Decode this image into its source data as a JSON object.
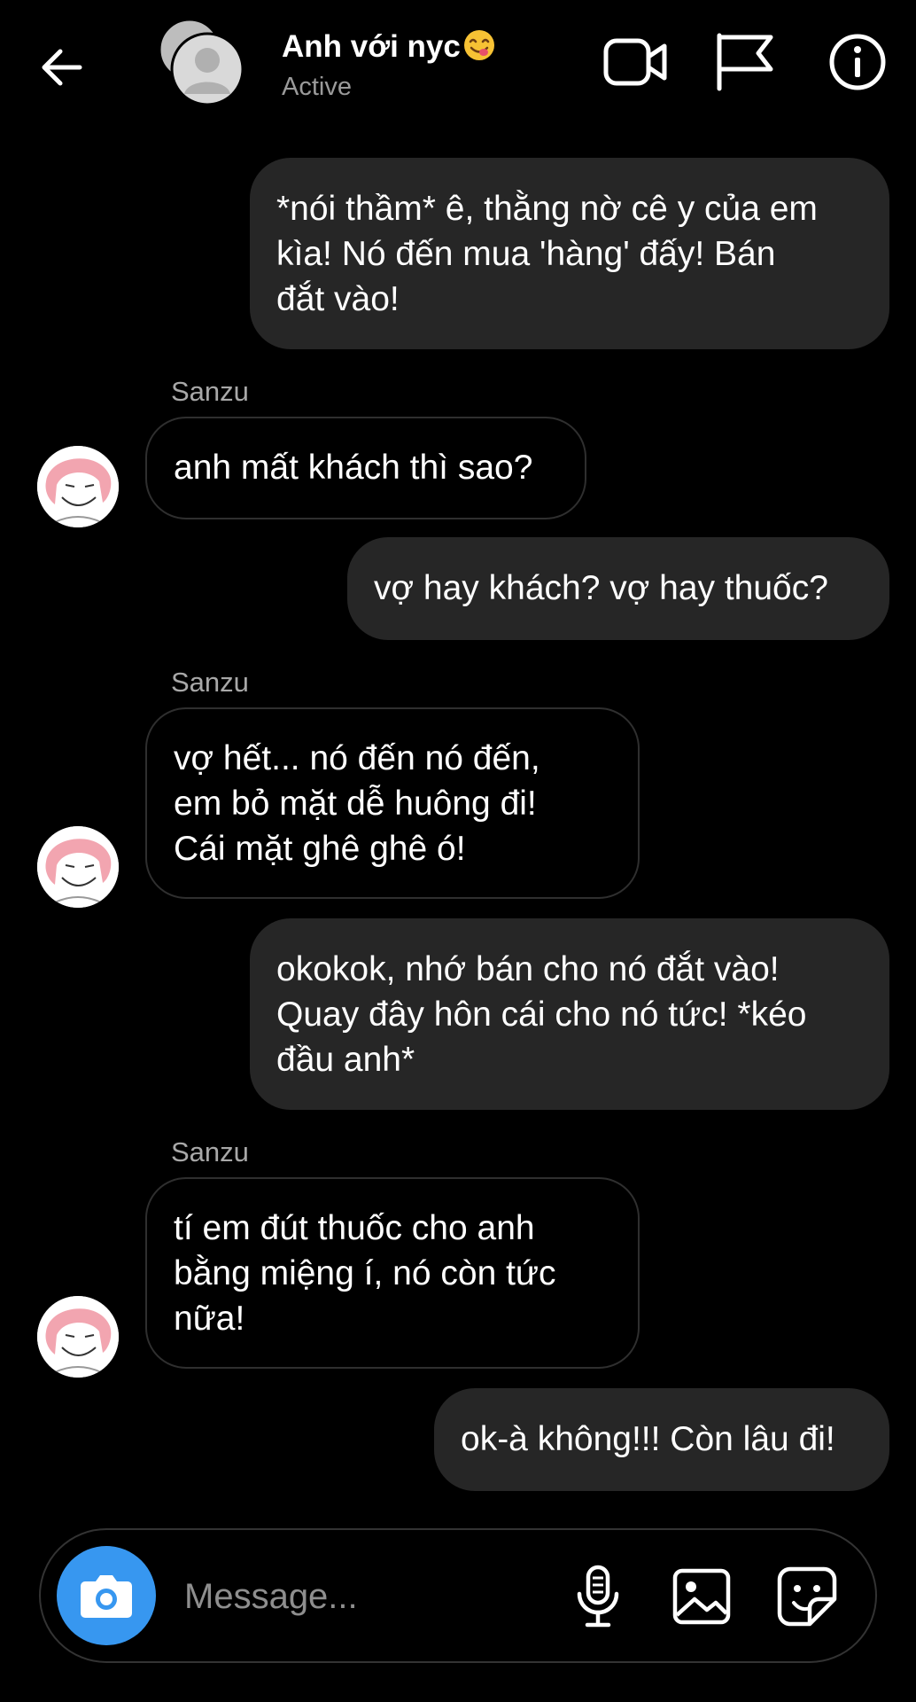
{
  "header": {
    "title": "Anh với nyc",
    "status": "Active"
  },
  "messages": [
    {
      "direction": "out",
      "text_lines": [
        "*nói thầm* ê, thằng nờ cê y của em",
        "kìa! Nó đến mua 'hàng' đấy! Bán",
        "đắt vào!"
      ]
    },
    {
      "direction": "in",
      "sender": "Sanzu",
      "text_lines": [
        "anh mất khách thì sao?"
      ]
    },
    {
      "direction": "out",
      "text_lines": [
        "vợ hay khách? vợ hay thuốc?"
      ]
    },
    {
      "direction": "in",
      "sender": "Sanzu",
      "text_lines": [
        "vợ hết... nó đến nó đến,",
        "em bỏ mặt dễ huông đi!",
        "Cái mặt ghê ghê ó!"
      ]
    },
    {
      "direction": "out",
      "text_lines": [
        "okokok, nhớ bán cho nó đắt vào!",
        "Quay đây hôn cái cho nó tức! *kéo",
        "đầu anh*"
      ]
    },
    {
      "direction": "in",
      "sender": "Sanzu",
      "text_lines": [
        "tí em đút thuốc cho anh",
        "bằng miệng í, nó còn tức",
        "nữa!"
      ]
    },
    {
      "direction": "out",
      "text_lines": [
        "ok-à không!!! Còn lâu đi!"
      ]
    }
  ],
  "composer": {
    "placeholder": "Message..."
  },
  "icons": {
    "back": "arrow-left-icon",
    "video": "video-call-icon",
    "flag": "flag-icon",
    "info": "info-icon",
    "camera": "camera-icon",
    "mic": "microphone-icon",
    "gallery": "image-icon",
    "sticker": "sticker-icon"
  },
  "colors": {
    "background": "#000000",
    "outgoing_bubble": "#262626",
    "accent": "#3797f0"
  }
}
